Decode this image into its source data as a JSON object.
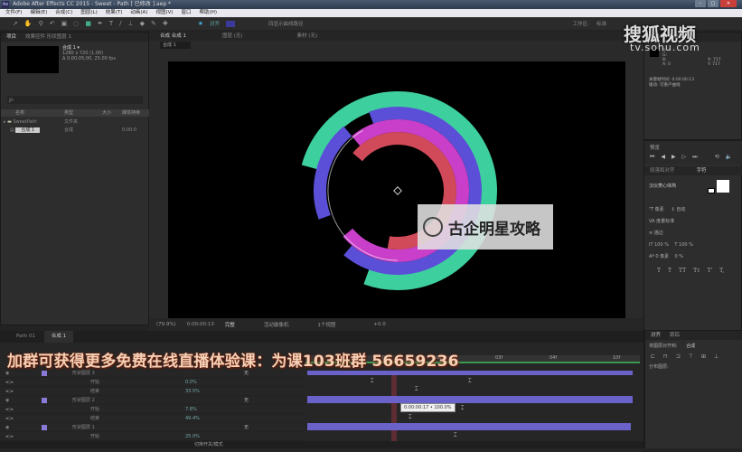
{
  "window": {
    "title": "Adobe After Effects CC 2015 - Sweet - Path [ 已修改 ].aep *",
    "app_icon": "Ae",
    "buttons": [
      "–",
      "□",
      "✕"
    ]
  },
  "menu": [
    "文件(F)",
    "编辑(E)",
    "合成(C)",
    "图层(L)",
    "效果(T)",
    "动画(A)",
    "视图(V)",
    "窗口",
    "帮助(H)"
  ],
  "toolbar": {
    "snap": "对齐",
    "workspace_label": "工作区:",
    "workspace": "标准",
    "motion_path": "四显示曲线路径"
  },
  "project": {
    "tabs": [
      "项目",
      "效果控件 形状图层 1"
    ],
    "comp_name": "合成 1 ▾",
    "comp_size": "1280 x 720 (1.00)",
    "comp_duration": "Δ 0;00;05;00, 25.00 fps",
    "search_placeholder": "ρ-",
    "columns": [
      "名称",
      "类型",
      "大小",
      "媒体持续"
    ],
    "items": [
      {
        "name": "SweetPath",
        "type": "文件夹",
        "size": "",
        "dur": ""
      },
      {
        "name": "合成 1",
        "type": "合成",
        "size": "",
        "dur": "0:00:0"
      }
    ]
  },
  "viewer": {
    "tabs": [
      "合成 合成 1",
      "图层 (无)",
      "素材 (无)"
    ],
    "sub_tab": "合成 1",
    "zoom": "(79.9%)",
    "timecode": "0:00:00:13",
    "quality": "完整",
    "camera": "活动摄像机",
    "views": "1个视图",
    "exposure": "+0.0"
  },
  "watermark": {
    "text": "古企明星攻略",
    "brand": "搜狐视频",
    "url": "tv.sohu.com"
  },
  "rings": {
    "colors": [
      "#3ecf9e",
      "#5a4fd6",
      "#c93fc9",
      "#d04a5a",
      "#ffffff"
    ]
  },
  "info_panel": {
    "tabs": [
      "信息",
      "音频"
    ],
    "line1": "关键帧时间: 0:00:00:13",
    "line2": "缓动: 可重产曲线",
    "rgb": [
      "R:",
      "G:",
      "B:",
      "A: 0"
    ],
    "xy": [
      "X: 717",
      "Y: 717"
    ]
  },
  "preview_panel": {
    "title": "预览"
  },
  "character_panel": {
    "tabs": [
      "段落和对齐",
      "字符"
    ],
    "font": "汉仪菱心体简",
    "size": "像素",
    "leading": "自动",
    "tracking": "度量标准",
    "stroke": "描边",
    "scale_v": "100 %",
    "scale_h": "100 %",
    "baseline": "0 像素",
    "tsume": "0 %",
    "styles": [
      "T",
      "T",
      "TT",
      "Tт",
      "T'",
      "T,"
    ]
  },
  "timeline": {
    "tabs": [
      "Path 01",
      "合成 1"
    ],
    "layers": [
      {
        "name": "形状图层 3",
        "val": "",
        "mode": "无"
      },
      {
        "name": "开始",
        "val": "0.0%",
        "mode": ""
      },
      {
        "name": "结束",
        "val": "33.5%",
        "mode": ""
      },
      {
        "name": "形状图层 2",
        "val": "",
        "mode": "无"
      },
      {
        "name": "开始",
        "val": "7.8%",
        "mode": ""
      },
      {
        "name": "结束",
        "val": "49.4%",
        "mode": ""
      },
      {
        "name": "形状图层 1",
        "val": "",
        "mode": "无"
      },
      {
        "name": "开始",
        "val": "25.0%",
        "mode": ""
      }
    ],
    "ruler": [
      "01f",
      "02f",
      "03f",
      "04f",
      "05f",
      "10f"
    ],
    "tooltip": "0:00:00:17 • 100.0%",
    "footer": "切换开关/模式",
    "playhead_color": "#c83c50",
    "bar_color": "#6a62c8"
  },
  "subtitle": "加群可获得更多免费在线直播体验课：为课103班群 56659236",
  "align_panel": {
    "tabs": [
      "对齐",
      "跟踪"
    ],
    "align_to_label": "将图层对齐到:",
    "align_to": "合成",
    "distribute": "分布图层:"
  }
}
